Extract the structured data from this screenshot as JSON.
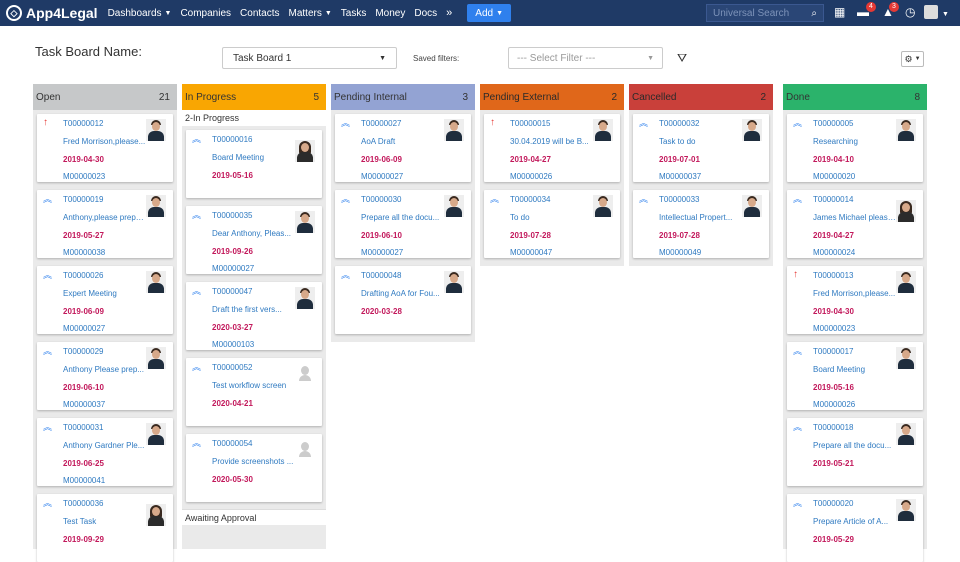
{
  "nav": {
    "logo": "App4Legal",
    "items": [
      {
        "label": "Dashboards",
        "caret": true
      },
      {
        "label": "Companies",
        "caret": false
      },
      {
        "label": "Contacts",
        "caret": false
      },
      {
        "label": "Matters",
        "caret": true
      },
      {
        "label": "Tasks",
        "caret": false
      },
      {
        "label": "Money",
        "caret": false
      },
      {
        "label": "Docs",
        "caret": false
      }
    ],
    "more_icon": "double-chevron-down-icon",
    "add_label": "Add",
    "search_placeholder": "Universal Search",
    "messages_count": "4",
    "notifications_count": "3"
  },
  "toolbar": {
    "board_label": "Task Board Name:",
    "board_value": "Task Board 1",
    "saved_filters_label": "Saved filters:",
    "filter_placeholder": "--- Select Filter ---"
  },
  "colors": {
    "open": "#c6c8c9",
    "in_progress": "#f9a602",
    "pending_internal": "#93a3d3",
    "pending_external": "#e0671a",
    "cancelled": "#c9403a",
    "done": "#2bb36b",
    "priority_high": "#e53935",
    "priority_medium": "#2f80ed"
  },
  "columns": [
    {
      "name": "Open",
      "count": "21",
      "color": "#c6c8c9",
      "cards": [
        {
          "id": "T00000012",
          "name": "Fred Morrison,please...",
          "date": "2019-04-30",
          "matter": "M00000023",
          "priority": "high",
          "avatar": "male"
        },
        {
          "id": "T00000019",
          "name": "Anthony,please prepa...",
          "date": "2019-05-27",
          "matter": "M00000038",
          "priority": "medium",
          "avatar": "male"
        },
        {
          "id": "T00000026",
          "name": "Expert Meeting",
          "date": "2019-06-09",
          "matter": "M00000027",
          "priority": "medium",
          "avatar": "male"
        },
        {
          "id": "T00000029",
          "name": "Anthony Please prep...",
          "date": "2019-06-10",
          "matter": "M00000037",
          "priority": "medium",
          "avatar": "male"
        },
        {
          "id": "T00000031",
          "name": "Anthony Gardner Ple...",
          "date": "2019-06-25",
          "matter": "M00000041",
          "priority": "medium",
          "avatar": "male"
        },
        {
          "id": "T00000036",
          "name": "Test Task",
          "date": "2019-09-29",
          "matter": "",
          "priority": "medium",
          "avatar": "female"
        }
      ]
    },
    {
      "name": "In Progress",
      "count": "5",
      "color": "#f9a602",
      "sub1": "2-In Progress",
      "sub2": "Awaiting Approval",
      "cards": [
        {
          "id": "T00000016",
          "name": "Board Meeting",
          "date": "2019-05-16",
          "matter": "",
          "priority": "medium",
          "avatar": "female"
        },
        {
          "id": "T00000035",
          "name": "Dear Anthony, Pleas...",
          "date": "2019-09-26",
          "matter": "M00000027",
          "priority": "medium",
          "avatar": "male"
        },
        {
          "id": "T00000047",
          "name": "Draft the first vers...",
          "date": "2020-03-27",
          "matter": "M00000103",
          "priority": "medium",
          "avatar": "male"
        },
        {
          "id": "T00000052",
          "name": "Test workflow screen",
          "date": "2020-04-21",
          "matter": "",
          "priority": "medium",
          "avatar": "ghost"
        },
        {
          "id": "T00000054",
          "name": "Provide screenshots ...",
          "date": "2020-05-30",
          "matter": "",
          "priority": "medium",
          "avatar": "ghost"
        }
      ]
    },
    {
      "name": "Pending Internal",
      "count": "3",
      "color": "#93a3d3",
      "cards": [
        {
          "id": "T00000027",
          "name": "AoA Draft",
          "date": "2019-06-09",
          "matter": "M00000027",
          "priority": "medium",
          "avatar": "male"
        },
        {
          "id": "T00000030",
          "name": "Prepare all the docu...",
          "date": "2019-06-10",
          "matter": "M00000027",
          "priority": "medium",
          "avatar": "male"
        },
        {
          "id": "T00000048",
          "name": "Drafting AoA for Fou...",
          "date": "2020-03-28",
          "matter": "",
          "priority": "medium",
          "avatar": "male"
        }
      ]
    },
    {
      "name": "Pending External",
      "count": "2",
      "color": "#e0671a",
      "cards": [
        {
          "id": "T00000015",
          "name": "30.04.2019 will be B...",
          "date": "2019-04-27",
          "matter": "M00000026",
          "priority": "high",
          "avatar": "male"
        },
        {
          "id": "T00000034",
          "name": "To do",
          "date": "2019-07-28",
          "matter": "M00000047",
          "priority": "medium",
          "avatar": "male"
        }
      ]
    },
    {
      "name": "Cancelled",
      "count": "2",
      "color": "#c9403a",
      "cards": [
        {
          "id": "T00000032",
          "name": "Task to do",
          "date": "2019-07-01",
          "matter": "M00000037",
          "priority": "medium",
          "avatar": "male"
        },
        {
          "id": "T00000033",
          "name": "Intellectual Propert...",
          "date": "2019-07-28",
          "matter": "M00000049",
          "priority": "medium",
          "avatar": "male"
        }
      ]
    },
    {
      "name": "Done",
      "count": "8",
      "color": "#2bb36b",
      "cards": [
        {
          "id": "T00000005",
          "name": "Researching",
          "date": "2019-04-10",
          "matter": "M00000020",
          "priority": "medium",
          "avatar": "male"
        },
        {
          "id": "T00000014",
          "name": "James Michael please...",
          "date": "2019-04-27",
          "matter": "M00000024",
          "priority": "medium",
          "avatar": "female"
        },
        {
          "id": "T00000013",
          "name": "Fred Morrison,please...",
          "date": "2019-04-30",
          "matter": "M00000023",
          "priority": "high",
          "avatar": "male"
        },
        {
          "id": "T00000017",
          "name": "Board Meeting",
          "date": "2019-05-16",
          "matter": "M00000026",
          "priority": "medium",
          "avatar": "male"
        },
        {
          "id": "T00000018",
          "name": "Prepare all the docu...",
          "date": "2019-05-21",
          "matter": "",
          "priority": "medium",
          "avatar": "male"
        },
        {
          "id": "T00000020",
          "name": "Prepare Article of A...",
          "date": "2019-05-29",
          "matter": "",
          "priority": "medium",
          "avatar": "male"
        }
      ]
    }
  ]
}
